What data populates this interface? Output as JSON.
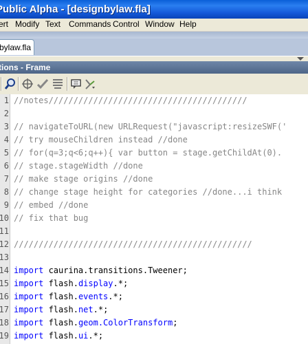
{
  "window": {
    "title": "Public Alpha - [designbylaw.fla]"
  },
  "menubar": {
    "items": [
      "ert",
      "Modify",
      "Text",
      "Commands",
      "Control",
      "Window",
      "Help"
    ]
  },
  "document_tab": {
    "label": "bylaw.fla"
  },
  "panel": {
    "title": "tions - Frame"
  },
  "toolbar": {
    "icons": [
      "find-icon",
      "target-path-icon",
      "check-syntax-icon",
      "auto-format-icon",
      "show-code-hint-icon",
      "debug-options-icon"
    ]
  },
  "code": {
    "line_numbers": [
      "1",
      "2",
      "3",
      "4",
      "5",
      "6",
      "7",
      "8",
      "9",
      "10",
      "11",
      "12",
      "13",
      "14",
      "15",
      "16",
      "17",
      "18"
    ],
    "lines": [
      {
        "type": "comment",
        "text": "//notes////////////////////////////////////////"
      },
      {
        "type": "blank",
        "text": ""
      },
      {
        "type": "comment",
        "text": "// navigateToURL(new URLRequest(\"javascript:resizeSWF(' "
      },
      {
        "type": "comment",
        "text": "// try mouseChildren instead //done"
      },
      {
        "type": "comment",
        "text": "// for(q=3;q<6;q++){ var button = stage.getChildAt(0)."
      },
      {
        "type": "comment",
        "text": "// stage.stageWidth //done"
      },
      {
        "type": "comment",
        "text": "// make stage origins //done"
      },
      {
        "type": "comment",
        "text": "// change stage height for categories //done...i think"
      },
      {
        "type": "comment",
        "text": "// embed //done"
      },
      {
        "type": "comment",
        "text": "// fix that bug"
      },
      {
        "type": "blank",
        "text": ""
      },
      {
        "type": "comment",
        "text": "////////////////////////////////////////////////"
      },
      {
        "type": "blank",
        "text": ""
      },
      {
        "type": "import",
        "kw": "import",
        "pkg": "caurina.transitions.Tweener",
        "rest": ";"
      },
      {
        "type": "import",
        "kw": "import",
        "pkg": "flash.",
        "cls": "display",
        "rest": ".*;"
      },
      {
        "type": "import",
        "kw": "import",
        "pkg": "flash.",
        "cls": "events",
        "rest": ".*;"
      },
      {
        "type": "import",
        "kw": "import",
        "pkg": "flash.",
        "cls": "net",
        "rest": ".*;"
      },
      {
        "type": "import",
        "kw": "import",
        "pkg": "flash.",
        "cls": "geom.ColorTransform",
        "rest": ";"
      },
      {
        "type": "import",
        "kw": "import",
        "pkg": "flash.",
        "cls": "ui",
        "rest": ".*;"
      }
    ]
  },
  "colors": {
    "comment": "#868686",
    "keyword": "#0000ff",
    "titlebar": "#0a5fd8",
    "panel_title": "#5a7296"
  }
}
